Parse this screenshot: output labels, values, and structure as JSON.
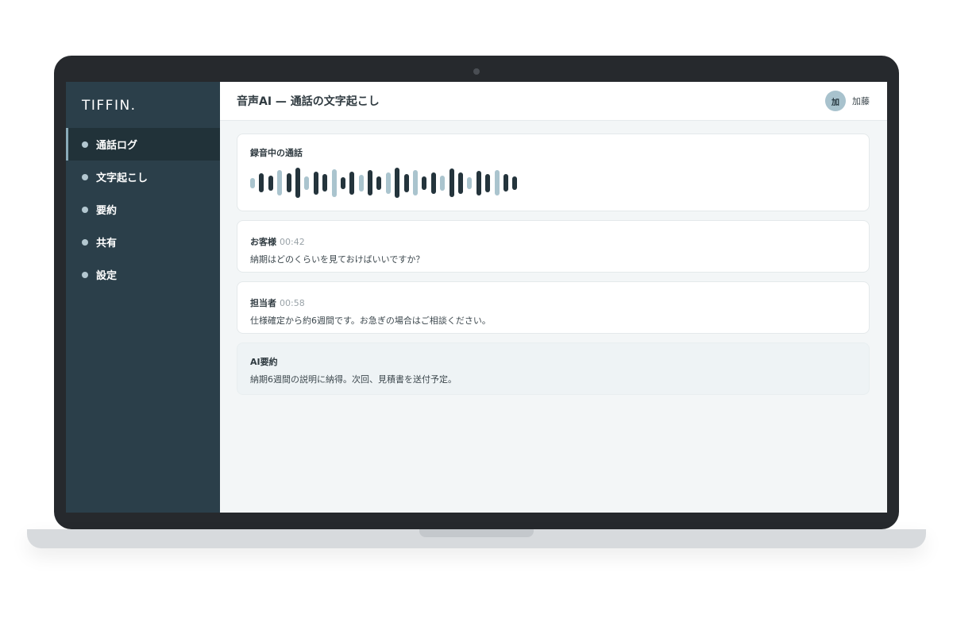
{
  "sidebar": {
    "brand": "TIFFIN.",
    "items": [
      {
        "label": "通話ログ",
        "active": true
      },
      {
        "label": "文字起こし",
        "active": false
      },
      {
        "label": "要約",
        "active": false
      },
      {
        "label": "共有",
        "active": false
      },
      {
        "label": "設定",
        "active": false
      }
    ]
  },
  "header": {
    "title": "音声AI — 通話の文字起こし",
    "user": {
      "avatar_initial": "加",
      "name": "加藤"
    }
  },
  "recording": {
    "title": "録音中の通話",
    "waveform": [
      {
        "level": 0.33,
        "tone": "light"
      },
      {
        "level": 0.62,
        "tone": "dark"
      },
      {
        "level": 0.5,
        "tone": "dark"
      },
      {
        "level": 0.85,
        "tone": "light"
      },
      {
        "level": 0.62,
        "tone": "dark"
      },
      {
        "level": 1.0,
        "tone": "dark"
      },
      {
        "level": 0.45,
        "tone": "light"
      },
      {
        "level": 0.75,
        "tone": "dark"
      },
      {
        "level": 0.58,
        "tone": "dark"
      },
      {
        "level": 0.92,
        "tone": "light"
      },
      {
        "level": 0.4,
        "tone": "dark"
      },
      {
        "level": 0.75,
        "tone": "dark"
      },
      {
        "level": 0.55,
        "tone": "light"
      },
      {
        "level": 0.85,
        "tone": "dark"
      },
      {
        "level": 0.45,
        "tone": "dark"
      },
      {
        "level": 0.7,
        "tone": "light"
      },
      {
        "level": 1.0,
        "tone": "dark"
      },
      {
        "level": 0.6,
        "tone": "dark"
      },
      {
        "level": 0.85,
        "tone": "light"
      },
      {
        "level": 0.45,
        "tone": "dark"
      },
      {
        "level": 0.7,
        "tone": "dark"
      },
      {
        "level": 0.5,
        "tone": "light"
      },
      {
        "level": 0.95,
        "tone": "dark"
      },
      {
        "level": 0.7,
        "tone": "dark"
      },
      {
        "level": 0.4,
        "tone": "light"
      },
      {
        "level": 0.82,
        "tone": "dark"
      },
      {
        "level": 0.6,
        "tone": "dark"
      },
      {
        "level": 0.85,
        "tone": "light"
      },
      {
        "level": 0.58,
        "tone": "dark"
      },
      {
        "level": 0.45,
        "tone": "dark"
      }
    ]
  },
  "messages": [
    {
      "speaker": "お客様",
      "time": "00:42",
      "text": "納期はどのくらいを見ておけばいいですか？"
    },
    {
      "speaker": "担当者",
      "time": "00:58",
      "text": "仕様確定から約6週間です。お急ぎの場合はご相談ください。"
    }
  ],
  "summary": {
    "title": "AI要約",
    "text": "納期6週間の説明に納得。次回、見積書を送付予定。"
  },
  "colors": {
    "sidebar_bg": "#2b3f4a",
    "wave_dark": "#24343c",
    "wave_light": "#aac4ce",
    "avatar_bg": "#a8c2cd"
  }
}
